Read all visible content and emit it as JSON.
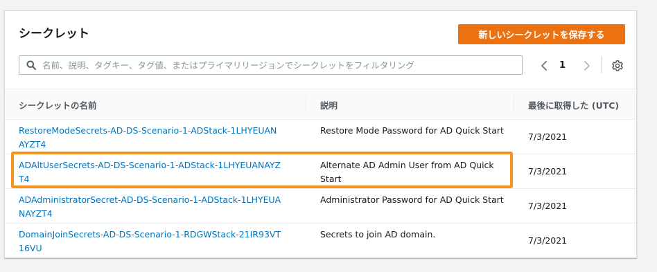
{
  "header": {
    "title": "シークレット",
    "create_button": "新しいシークレットを保存する"
  },
  "search": {
    "placeholder": "名前、説明、タグキー、タグ値、またはプライマリリージョンでシークレットをフィルタリング",
    "value": ""
  },
  "pagination": {
    "current_page": "1"
  },
  "table": {
    "columns": [
      "シークレットの名前",
      "説明",
      "最後に取得した (UTC)"
    ],
    "rows": [
      {
        "name": "RestoreModeSecrets-AD-DS-Scenario-1-ADStack-1LHYEUANAYZT4",
        "description": "Restore Mode Password for AD Quick Start",
        "last_retrieved": "7/3/2021"
      },
      {
        "name": "ADAltUserSecrets-AD-DS-Scenario-1-ADStack-1LHYEUANAYZT4",
        "description": "Alternate AD Admin User from AD Quick Start",
        "last_retrieved": "7/3/2021"
      },
      {
        "name": "ADAdministratorSecret-AD-DS-Scenario-1-ADStack-1LHYEUANAYZT4",
        "description": "Administrator Password for AD Quick Start",
        "last_retrieved": "7/3/2021"
      },
      {
        "name": "DomainJoinSecrets-AD-DS-Scenario-1-RDGWStack-21IR93VT16VU",
        "description": "Secrets to join AD domain.",
        "last_retrieved": "7/3/2021"
      }
    ]
  },
  "colors": {
    "accent": "#ec7211",
    "link": "#0073bb",
    "highlight": "#f7931e"
  },
  "icons": [
    "search-icon",
    "chevron-left-icon",
    "chevron-right-icon",
    "gear-icon"
  ]
}
